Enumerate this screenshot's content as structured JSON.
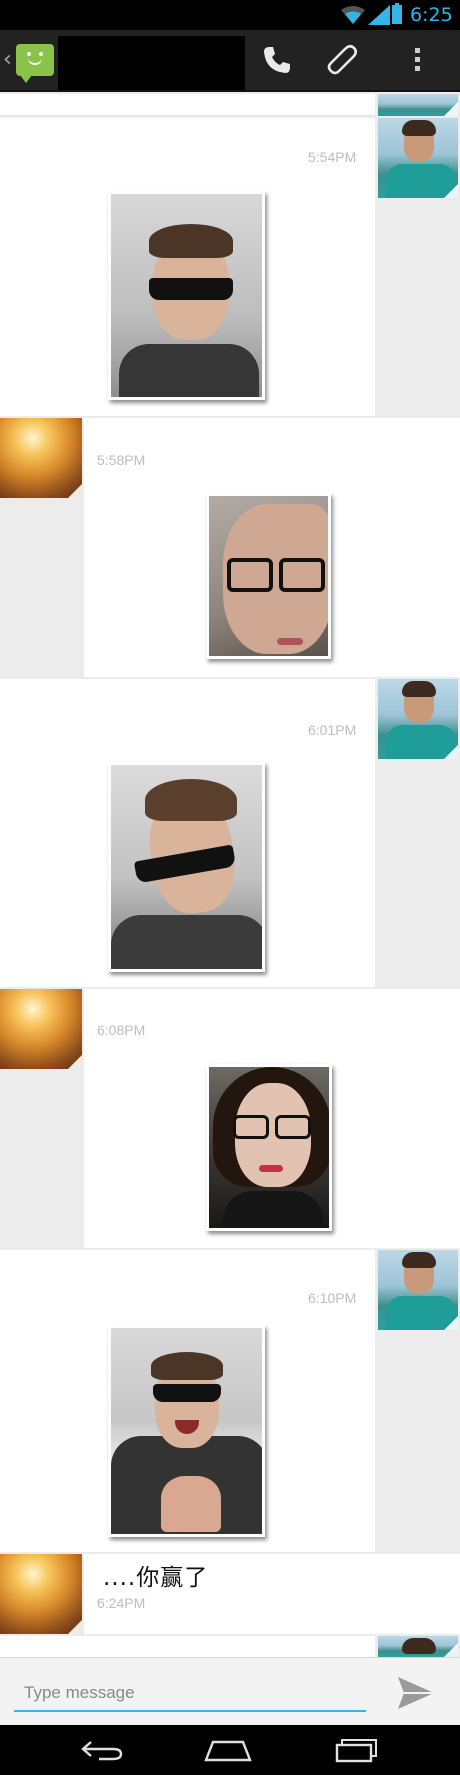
{
  "status_bar": {
    "time": "6:25"
  },
  "action_bar": {
    "app_icon": "messaging-smiley-icon",
    "call_icon": "phone-icon",
    "attach_icon": "paperclip-icon",
    "overflow_icon": "overflow-menu-icon"
  },
  "messages": [
    {
      "sender": "contact",
      "time": "5:54PM",
      "kind": "photo"
    },
    {
      "sender": "me",
      "time": "5:58PM",
      "kind": "photo"
    },
    {
      "sender": "contact",
      "time": "6:01PM",
      "kind": "photo"
    },
    {
      "sender": "me",
      "time": "6:08PM",
      "kind": "photo"
    },
    {
      "sender": "contact",
      "time": "6:10PM",
      "kind": "photo"
    },
    {
      "sender": "me",
      "time": "6:24PM",
      "kind": "text",
      "text": "....你赢了"
    },
    {
      "sender": "contact",
      "time": "",
      "kind": "cut-off"
    }
  ],
  "composer": {
    "placeholder": "Type message",
    "value": "",
    "send_icon": "send-icon"
  },
  "nav_bar": {
    "back_icon": "back-icon",
    "home_icon": "home-icon",
    "recents_icon": "recent-apps-icon"
  },
  "colors": {
    "accent": "#33b5e5",
    "action_bar": "#222222",
    "app_green": "#8bc34a"
  }
}
